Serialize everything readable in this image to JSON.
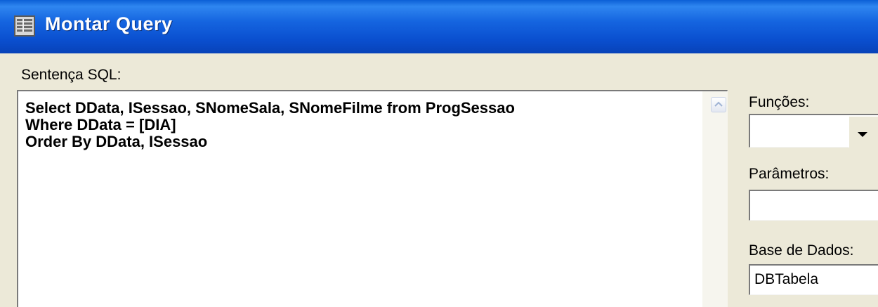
{
  "window": {
    "title": "Montar Query",
    "icon": "window-app-icon"
  },
  "sql": {
    "label": "Sentença SQL:",
    "text": "Select DData, ISessao, SNomeSala, SNomeFilme from ProgSessao\nWhere DData = [DIA]\nOrder By DData, ISessao"
  },
  "right_panel": {
    "funcoes_label": "Funções:",
    "funcoes_value": "",
    "parametros_label": "Parâmetros:",
    "parametros_value": "",
    "base_label": "Base de Dados:",
    "base_value": "DBTabela"
  },
  "icons": {
    "dropdown": "chevron-down-icon",
    "scroll_up": "scroll-up-icon"
  }
}
